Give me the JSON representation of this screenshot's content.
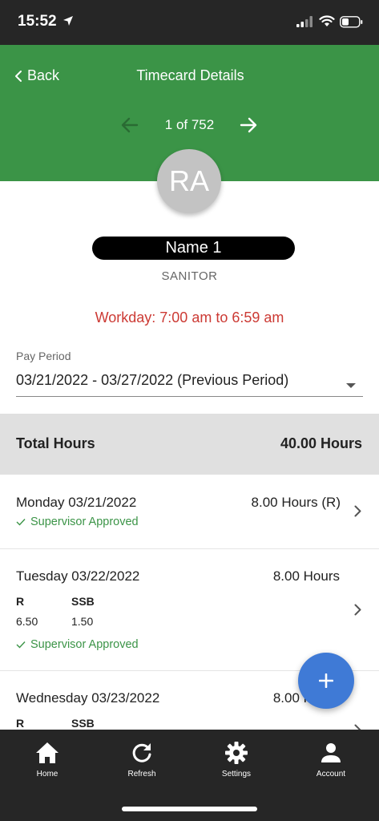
{
  "status_bar": {
    "time": "15:52"
  },
  "header": {
    "back_label": "Back",
    "title": "Timecard Details",
    "pager": "1 of 752"
  },
  "employee": {
    "initials": "RA",
    "name": "Name 1",
    "role": "SANITOR",
    "workday": "Workday: 7:00 am to 6:59 am"
  },
  "pay_period": {
    "label": "Pay Period",
    "value": "03/21/2022 - 03/27/2022 (Previous Period)"
  },
  "total": {
    "label": "Total Hours",
    "value": "40.00 Hours"
  },
  "days": [
    {
      "title": "Monday 03/21/2022",
      "hours": "8.00 Hours (R)",
      "status": "Supervisor Approved"
    },
    {
      "title": "Tuesday 03/22/2022",
      "hours": "8.00 Hours",
      "columns": [
        "R",
        "SSB"
      ],
      "values": [
        "6.50",
        "1.50"
      ],
      "status": "Supervisor Approved"
    },
    {
      "title": "Wednesday 03/23/2022",
      "hours": "8.00 Hours",
      "columns": [
        "R",
        "SSB"
      ]
    }
  ],
  "fab_icon": "plus-icon",
  "tabs": [
    {
      "label": "Home",
      "icon": "home-icon"
    },
    {
      "label": "Refresh",
      "icon": "refresh-icon"
    },
    {
      "label": "Settings",
      "icon": "gear-icon"
    },
    {
      "label": "Account",
      "icon": "person-icon"
    }
  ],
  "colors": {
    "header_green": "#3b9447",
    "workday_red": "#cc3a34",
    "fab_blue": "#3f7ad6",
    "bar_dark": "#262626"
  }
}
